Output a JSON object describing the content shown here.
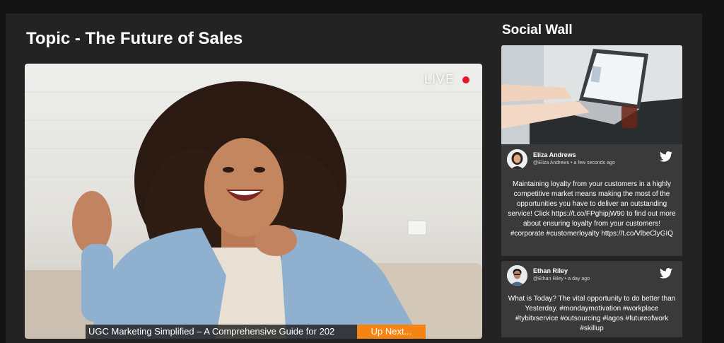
{
  "topic": {
    "label": "Topic",
    "separator": " - ",
    "title": "The Future of Sales"
  },
  "video": {
    "live_label": "LIVE",
    "caption": "UGC Marketing Simplified – A Comprehensive Guide for 202",
    "up_next_label": "Up Next..."
  },
  "social_wall": {
    "title": "Social Wall",
    "posts": [
      {
        "author": "Eliza Andrews",
        "handle": "@Eliza Andrews",
        "time": "a few seconds ago",
        "network_icon": "twitter-icon",
        "text": "Maintaining loyalty from your customers in a highly competitive market means making the most of the opportunities you have to deliver an outstanding service! Click https://t.co/FPghipjW90 to find out more about ensuring loyalty from your customers! #corporate #customerloyalty https://t.co/VlbeClyGIQ"
      },
      {
        "author": "Ethan Riley",
        "handle": "@Ethan Riley",
        "time": "a day ago",
        "network_icon": "twitter-icon",
        "text": "What is Today? The vital opportunity to do better than Yesterday. #mondaymotivation #workplace #tybitxservice #outsourcing #lagos #futureofwork #skillup"
      }
    ]
  },
  "colors": {
    "live_dot": "#e8182c",
    "up_next": "#f58413",
    "twitter": "#ffffff"
  }
}
